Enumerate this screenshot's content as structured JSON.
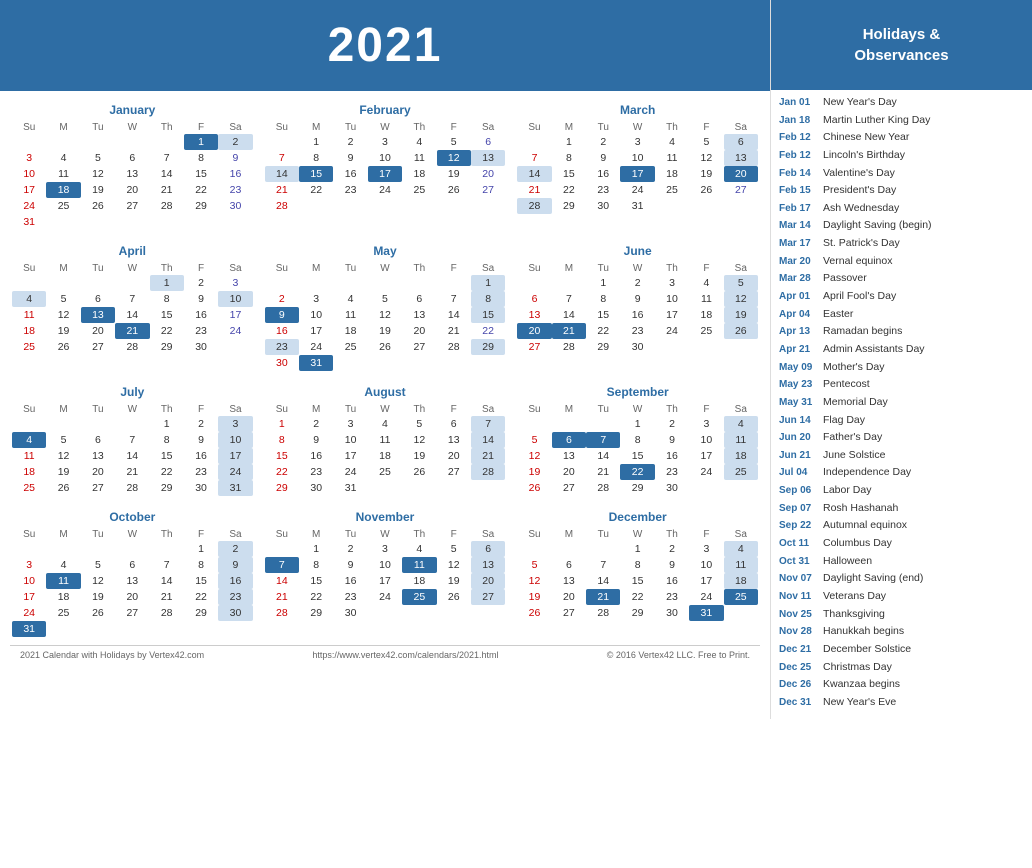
{
  "header": {
    "year": "2021"
  },
  "sidebar": {
    "title": "Holidays &\nObservances",
    "holidays": [
      {
        "date": "Jan 01",
        "name": "New Year's Day"
      },
      {
        "date": "Jan 18",
        "name": "Martin Luther King Day"
      },
      {
        "date": "Feb 12",
        "name": "Chinese New Year"
      },
      {
        "date": "Feb 12",
        "name": "Lincoln's Birthday"
      },
      {
        "date": "Feb 14",
        "name": "Valentine's Day"
      },
      {
        "date": "Feb 15",
        "name": "President's Day"
      },
      {
        "date": "Feb 17",
        "name": "Ash Wednesday"
      },
      {
        "date": "Mar 14",
        "name": "Daylight Saving (begin)"
      },
      {
        "date": "Mar 17",
        "name": "St. Patrick's Day"
      },
      {
        "date": "Mar 20",
        "name": "Vernal equinox"
      },
      {
        "date": "Mar 28",
        "name": "Passover"
      },
      {
        "date": "Apr 01",
        "name": "April Fool's Day"
      },
      {
        "date": "Apr 04",
        "name": "Easter"
      },
      {
        "date": "Apr 13",
        "name": "Ramadan begins"
      },
      {
        "date": "Apr 21",
        "name": "Admin Assistants Day"
      },
      {
        "date": "May 09",
        "name": "Mother's Day"
      },
      {
        "date": "May 23",
        "name": "Pentecost"
      },
      {
        "date": "May 31",
        "name": "Memorial Day"
      },
      {
        "date": "Jun 14",
        "name": "Flag Day"
      },
      {
        "date": "Jun 20",
        "name": "Father's Day"
      },
      {
        "date": "Jun 21",
        "name": "June Solstice"
      },
      {
        "date": "Jul 04",
        "name": "Independence Day"
      },
      {
        "date": "Sep 06",
        "name": "Labor Day"
      },
      {
        "date": "Sep 07",
        "name": "Rosh Hashanah"
      },
      {
        "date": "Sep 22",
        "name": "Autumnal equinox"
      },
      {
        "date": "Oct 11",
        "name": "Columbus Day"
      },
      {
        "date": "Oct 31",
        "name": "Halloween"
      },
      {
        "date": "Nov 07",
        "name": "Daylight Saving (end)"
      },
      {
        "date": "Nov 11",
        "name": "Veterans Day"
      },
      {
        "date": "Nov 25",
        "name": "Thanksgiving"
      },
      {
        "date": "Nov 28",
        "name": "Hanukkah begins"
      },
      {
        "date": "Dec 21",
        "name": "December Solstice"
      },
      {
        "date": "Dec 25",
        "name": "Christmas Day"
      },
      {
        "date": "Dec 26",
        "name": "Kwanzaa begins"
      },
      {
        "date": "Dec 31",
        "name": "New Year's Eve"
      }
    ]
  },
  "footer": {
    "left": "2021 Calendar with Holidays by Vertex42.com",
    "center": "https://www.vertex42.com/calendars/2021.html",
    "right": "© 2016 Vertex42 LLC. Free to Print."
  },
  "months": [
    {
      "name": "January",
      "days": [
        [
          null,
          null,
          null,
          null,
          null,
          1,
          2
        ],
        [
          3,
          4,
          5,
          6,
          7,
          8,
          9
        ],
        [
          10,
          11,
          12,
          13,
          14,
          15,
          16
        ],
        [
          17,
          18,
          19,
          20,
          21,
          22,
          23
        ],
        [
          24,
          25,
          26,
          27,
          28,
          29,
          30
        ],
        [
          31,
          null,
          null,
          null,
          null,
          null,
          null
        ]
      ],
      "highlights": [
        1,
        2,
        18
      ],
      "today": []
    },
    {
      "name": "February",
      "days": [
        [
          null,
          1,
          2,
          3,
          4,
          5,
          6
        ],
        [
          7,
          8,
          9,
          10,
          11,
          12,
          13
        ],
        [
          14,
          15,
          16,
          17,
          18,
          19,
          20
        ],
        [
          21,
          22,
          23,
          24,
          25,
          26,
          27
        ],
        [
          28,
          null,
          null,
          null,
          null,
          null,
          null
        ]
      ],
      "highlights": [
        12,
        13,
        14,
        15,
        17
      ],
      "today": []
    },
    {
      "name": "March",
      "days": [
        [
          null,
          1,
          2,
          3,
          4,
          5,
          6
        ],
        [
          7,
          8,
          9,
          10,
          11,
          12,
          13
        ],
        [
          14,
          15,
          16,
          17,
          18,
          19,
          20
        ],
        [
          21,
          22,
          23,
          24,
          25,
          26,
          27
        ],
        [
          28,
          29,
          30,
          31,
          null,
          null,
          null
        ]
      ],
      "highlights": [
        6,
        13,
        14,
        17,
        20,
        28
      ],
      "today": []
    },
    {
      "name": "April",
      "days": [
        [
          null,
          null,
          null,
          null,
          1,
          2,
          3
        ],
        [
          4,
          5,
          6,
          7,
          8,
          9,
          10
        ],
        [
          11,
          12,
          13,
          14,
          15,
          16,
          17
        ],
        [
          18,
          19,
          20,
          21,
          22,
          23,
          24
        ],
        [
          25,
          26,
          27,
          28,
          29,
          30,
          null
        ]
      ],
      "highlights": [
        1,
        4,
        13,
        21
      ],
      "today": []
    },
    {
      "name": "May",
      "days": [
        [
          null,
          null,
          null,
          null,
          null,
          null,
          1
        ],
        [
          2,
          3,
          4,
          5,
          6,
          7,
          8
        ],
        [
          9,
          10,
          11,
          12,
          13,
          14,
          15
        ],
        [
          16,
          17,
          18,
          19,
          20,
          21,
          22
        ],
        [
          23,
          24,
          25,
          26,
          27,
          28,
          29
        ],
        [
          30,
          31,
          null,
          null,
          null,
          null,
          null
        ]
      ],
      "highlights": [
        1,
        9,
        23,
        31
      ],
      "today": []
    },
    {
      "name": "June",
      "days": [
        [
          null,
          null,
          1,
          2,
          3,
          4,
          5
        ],
        [
          6,
          7,
          8,
          9,
          10,
          11,
          12
        ],
        [
          13,
          14,
          15,
          16,
          17,
          18,
          19
        ],
        [
          20,
          21,
          22,
          23,
          24,
          25,
          26
        ],
        [
          27,
          28,
          29,
          30,
          null,
          null,
          null
        ]
      ],
      "highlights": [
        5,
        12,
        13,
        14,
        19,
        20,
        21
      ],
      "today": []
    },
    {
      "name": "July",
      "days": [
        [
          null,
          null,
          null,
          null,
          1,
          2,
          3
        ],
        [
          4,
          5,
          6,
          7,
          8,
          9,
          10
        ],
        [
          11,
          12,
          13,
          14,
          15,
          16,
          17
        ],
        [
          18,
          19,
          20,
          21,
          22,
          23,
          24
        ],
        [
          25,
          26,
          27,
          28,
          29,
          30,
          31
        ]
      ],
      "highlights": [
        4
      ],
      "today": []
    },
    {
      "name": "August",
      "days": [
        [
          1,
          2,
          3,
          4,
          5,
          6,
          7
        ],
        [
          8,
          9,
          10,
          11,
          12,
          13,
          14
        ],
        [
          15,
          16,
          17,
          18,
          19,
          20,
          21
        ],
        [
          22,
          23,
          24,
          25,
          26,
          27,
          28
        ],
        [
          29,
          30,
          31,
          null,
          null,
          null,
          null
        ]
      ],
      "highlights": [],
      "today": []
    },
    {
      "name": "September",
      "days": [
        [
          null,
          null,
          null,
          1,
          2,
          3,
          4
        ],
        [
          5,
          6,
          7,
          8,
          9,
          10,
          11
        ],
        [
          12,
          13,
          14,
          15,
          16,
          17,
          18
        ],
        [
          19,
          20,
          21,
          22,
          23,
          24,
          25
        ],
        [
          26,
          27,
          28,
          29,
          30,
          null,
          null
        ]
      ],
      "highlights": [
        4,
        6,
        7,
        11,
        18,
        22,
        25
      ],
      "today": []
    },
    {
      "name": "October",
      "days": [
        [
          null,
          null,
          null,
          null,
          null,
          1,
          2
        ],
        [
          3,
          4,
          5,
          6,
          7,
          8,
          9
        ],
        [
          10,
          11,
          12,
          13,
          14,
          15,
          16
        ],
        [
          17,
          18,
          19,
          20,
          21,
          22,
          23
        ],
        [
          24,
          25,
          26,
          27,
          28,
          29,
          30
        ],
        [
          31,
          null,
          null,
          null,
          null,
          null,
          null
        ]
      ],
      "highlights": [
        11,
        31
      ],
      "today": []
    },
    {
      "name": "November",
      "days": [
        [
          null,
          1,
          2,
          3,
          4,
          5,
          6
        ],
        [
          7,
          8,
          9,
          10,
          11,
          12,
          13
        ],
        [
          14,
          15,
          16,
          17,
          18,
          19,
          20
        ],
        [
          21,
          22,
          23,
          24,
          25,
          26,
          27
        ],
        [
          28,
          29,
          30,
          null,
          null,
          null,
          null
        ]
      ],
      "highlights": [
        6,
        7,
        11,
        13,
        20,
        25,
        28
      ],
      "today": []
    },
    {
      "name": "December",
      "days": [
        [
          null,
          null,
          null,
          1,
          2,
          3,
          4
        ],
        [
          5,
          6,
          7,
          8,
          9,
          10,
          11
        ],
        [
          12,
          13,
          14,
          15,
          16,
          17,
          18
        ],
        [
          19,
          20,
          21,
          22,
          23,
          24,
          25
        ],
        [
          26,
          27,
          28,
          29,
          30,
          31,
          null
        ]
      ],
      "highlights": [
        4,
        11,
        18,
        21,
        25,
        26,
        31
      ],
      "today": []
    }
  ]
}
